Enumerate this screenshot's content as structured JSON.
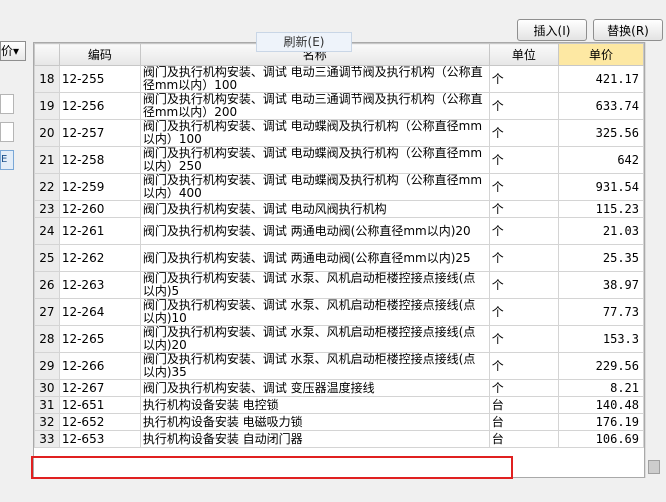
{
  "toolbar": {
    "insert_label": "插入(I)",
    "replace_label": "替换(R)"
  },
  "left_panel": {
    "price_select_label": "价",
    "box_label": "E"
  },
  "context_menu": {
    "refresh_label": "刷新(E)"
  },
  "table": {
    "headers": {
      "index": "",
      "code": "编码",
      "name": "名称",
      "unit": "单位",
      "price": "单价"
    },
    "rows": [
      {
        "idx": "18",
        "code": "12-255",
        "name": "阀门及执行机构安装、调试 电动三通调节阀及执行机构（公称直径mm以内）100",
        "unit": "个",
        "price": "421.17"
      },
      {
        "idx": "19",
        "code": "12-256",
        "name": "阀门及执行机构安装、调试 电动三通调节阀及执行机构（公称直径mm以内）200",
        "unit": "个",
        "price": "633.74"
      },
      {
        "idx": "20",
        "code": "12-257",
        "name": "阀门及执行机构安装、调试 电动蝶阀及执行机构（公称直径mm以内）100",
        "unit": "个",
        "price": "325.56"
      },
      {
        "idx": "21",
        "code": "12-258",
        "name": "阀门及执行机构安装、调试 电动蝶阀及执行机构（公称直径mm以内）250",
        "unit": "个",
        "price": "642"
      },
      {
        "idx": "22",
        "code": "12-259",
        "name": "阀门及执行机构安装、调试 电动蝶阀及执行机构（公称直径mm以内）400",
        "unit": "个",
        "price": "931.54"
      },
      {
        "idx": "23",
        "code": "12-260",
        "name": "阀门及执行机构安装、调试 电动风阀执行机构",
        "unit": "个",
        "price": "115.23"
      },
      {
        "idx": "24",
        "code": "12-261",
        "name": "阀门及执行机构安装、调试 两通电动阀(公称直径mm以内)20",
        "unit": "个",
        "price": "21.03"
      },
      {
        "idx": "25",
        "code": "12-262",
        "name": "阀门及执行机构安装、调试 两通电动阀(公称直径mm以内)25",
        "unit": "个",
        "price": "25.35"
      },
      {
        "idx": "26",
        "code": "12-263",
        "name": "阀门及执行机构安装、调试 水泵、风机启动柜楼控接点接线(点以内)5",
        "unit": "个",
        "price": "38.97"
      },
      {
        "idx": "27",
        "code": "12-264",
        "name": "阀门及执行机构安装、调试 水泵、风机启动柜楼控接点接线(点以内)10",
        "unit": "个",
        "price": "77.73"
      },
      {
        "idx": "28",
        "code": "12-265",
        "name": "阀门及执行机构安装、调试 水泵、风机启动柜楼控接点接线(点以内)20",
        "unit": "个",
        "price": "153.3"
      },
      {
        "idx": "29",
        "code": "12-266",
        "name": "阀门及执行机构安装、调试 水泵、风机启动柜楼控接点接线(点以内)35",
        "unit": "个",
        "price": "229.56"
      },
      {
        "idx": "30",
        "code": "12-267",
        "name": "阀门及执行机构安装、调试 变压器温度接线",
        "unit": "个",
        "price": "8.21"
      },
      {
        "idx": "31",
        "code": "12-651",
        "name": "执行机构设备安装 电控锁",
        "unit": "台",
        "price": "140.48"
      },
      {
        "idx": "32",
        "code": "12-652",
        "name": "执行机构设备安装 电磁吸力锁",
        "unit": "台",
        "price": "176.19"
      },
      {
        "idx": "33",
        "code": "12-653",
        "name": "执行机构设备安装 自动闭门器",
        "unit": "台",
        "price": "106.69"
      }
    ]
  },
  "colors": {
    "price_header": "#fde8a3",
    "highlight_border": "#e02020"
  }
}
